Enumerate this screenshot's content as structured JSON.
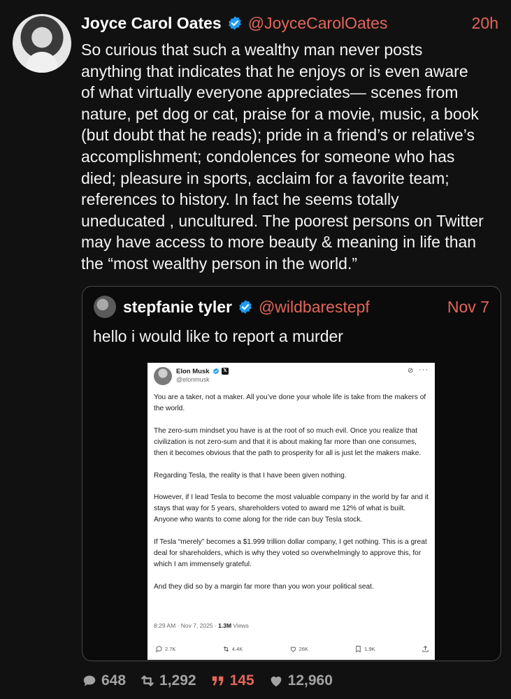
{
  "post": {
    "author_name": "Joyce Carol Oates",
    "handle": "@JoyceCarolOates",
    "time": "20h",
    "text": "So curious that such a wealthy man never posts\nanything that indicates that he enjoys or is even aware\nof what virtually everyone appreciates— scenes from\nnature, pet dog or cat, praise for a movie, music, a book\n(but doubt that he reads); pride in a friend’s or relative’s\naccomplishment; condolences for someone who has\ndied; pleasure in sports, acclaim for a favorite team;\nreferences to history.  In fact he seems totally\nuneducated , uncultured. The poorest persons on Twitter\nmay have access to more beauty & meaning in life than\nthe “most wealthy person in the world.”"
  },
  "quote": {
    "author_name": "stepfanie tyler",
    "handle": "@wildbarestepf",
    "time": "Nov 7",
    "text": "hello i would like to report a murder"
  },
  "embedded": {
    "author_name": "Elon Musk",
    "handle": "@elonmusk",
    "paragraphs": [
      "You are a taker, not a maker. All you’ve done your whole life is take from the makers of the world.",
      "The zero-sum mindset you have is at the root of so much evil. Once you realize that civilization is not zero-sum and that it is about making far more than one consumes, then it becomes obvious that the path to prosperity for all is just let the makers make.",
      "Regarding Tesla, the reality is that I have been given nothing.",
      "However, if I lead Tesla to become the most valuable company in the world by far and it stays that way for 5 years, shareholders voted to award me 12% of what is built. Anyone who wants to come along for the ride can buy Tesla stock.",
      "If Tesla “merely” becomes a $1.999 trillion dollar company, I get nothing. This is a great deal for shareholders, which is why they voted so overwhelmingly to approve this, for which I am immensely grateful.",
      "And they did so by a margin far more than you won your political seat."
    ],
    "timestamp": "8:29 AM · Nov 7, 2025 · ",
    "views_count": "1.3M",
    "views_label": " Views",
    "replies": "2.7K",
    "reposts": "4.4K",
    "likes": "26K",
    "bookmarks": "1.9K"
  },
  "footer": {
    "replies": "648",
    "reposts": "1,292",
    "quotes": "145",
    "likes": "12,960"
  },
  "colors": {
    "background": "#111111",
    "accent": "#e4665a",
    "verified": "#1d9bf0",
    "muted": "#a3a3a3"
  },
  "icons": [
    "verified-badge-icon",
    "x-logo-icon",
    "grok-icon",
    "more-icon",
    "reply-icon",
    "repost-icon",
    "like-icon",
    "bookmark-icon",
    "share-icon",
    "quote-icon"
  ]
}
